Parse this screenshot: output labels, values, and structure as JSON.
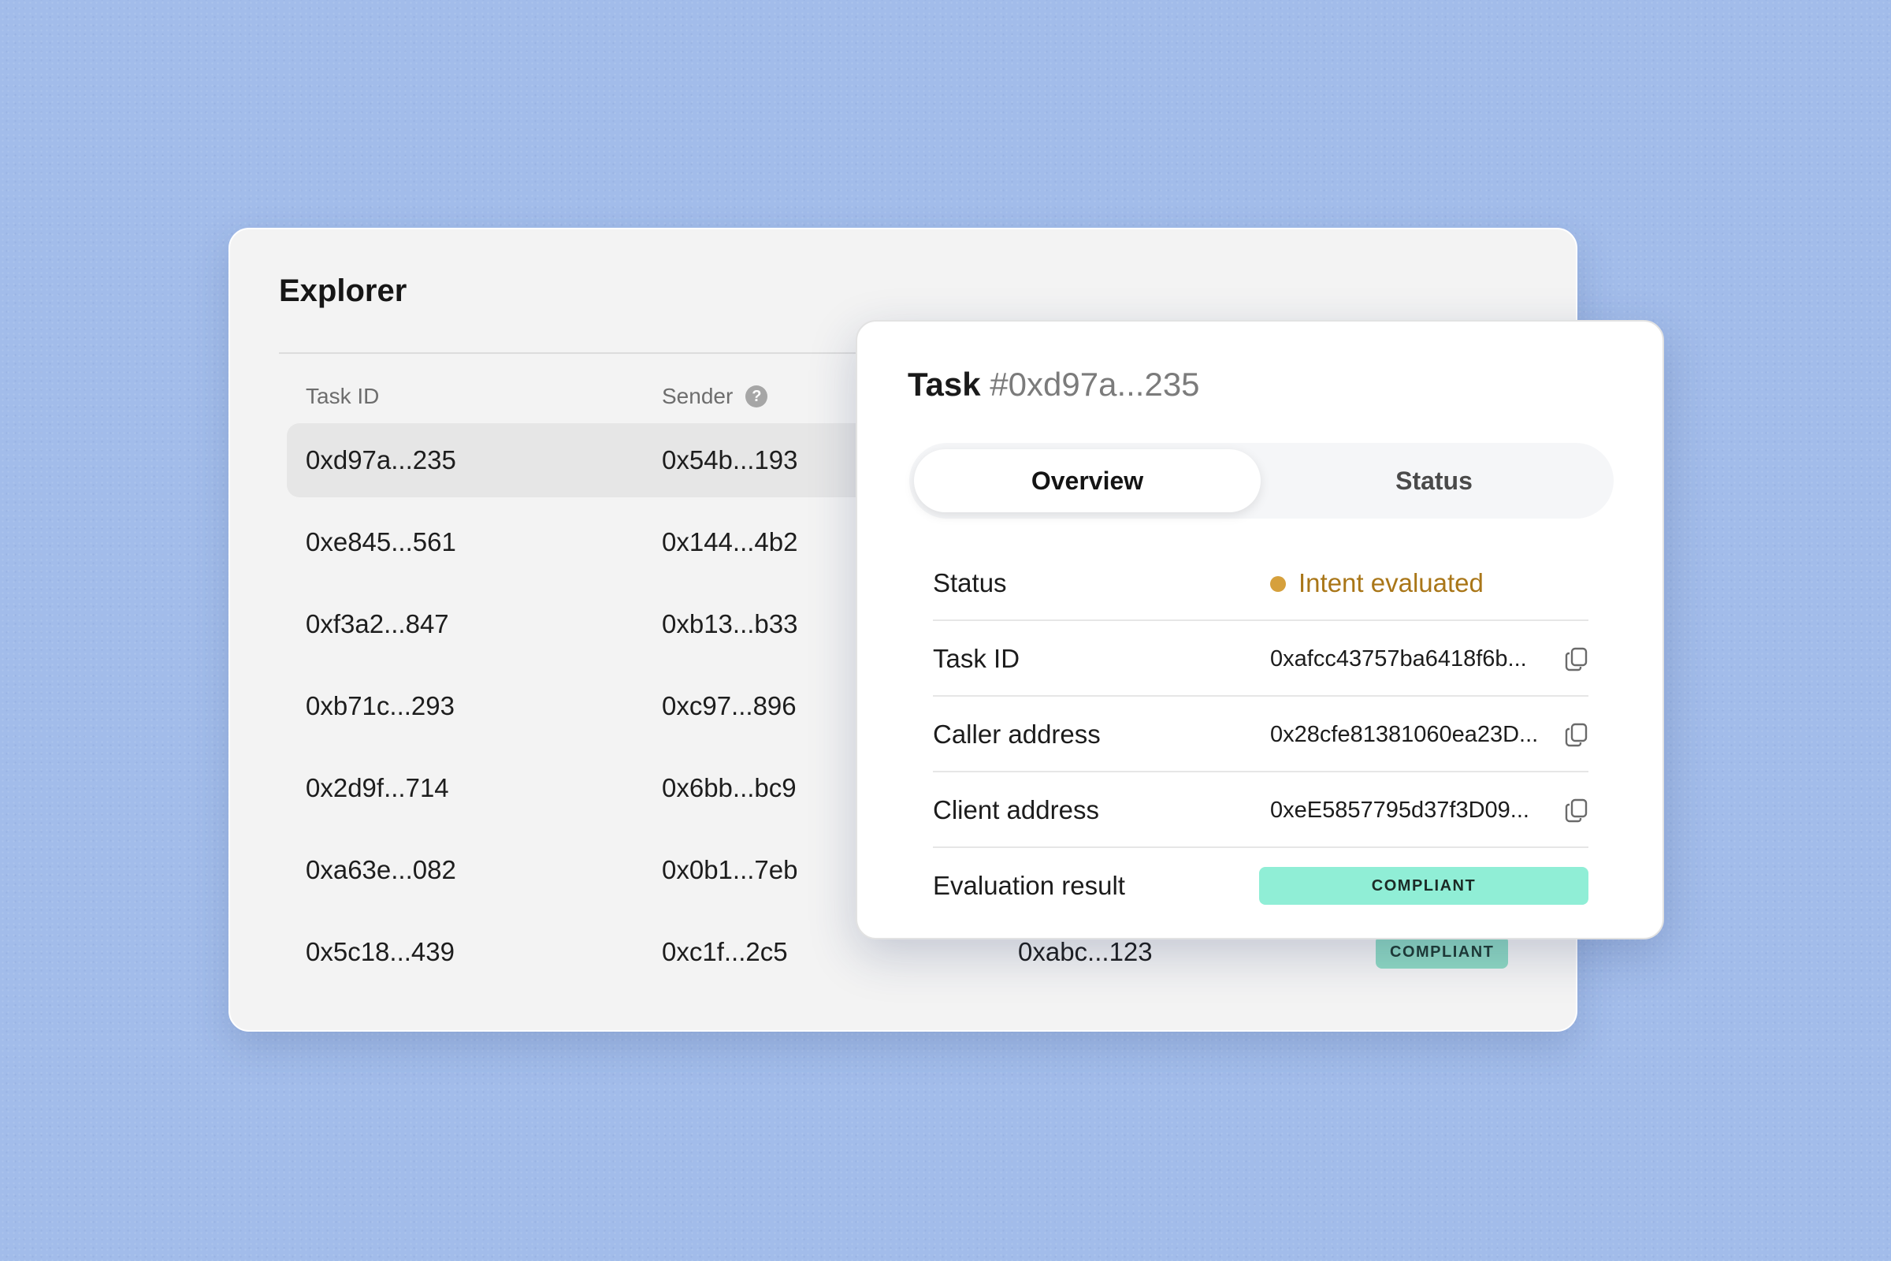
{
  "explorer": {
    "title": "Explorer",
    "columns": {
      "task_id": "Task ID",
      "sender": "Sender"
    },
    "rows": [
      {
        "task_id": "0xd97a...235",
        "sender": "0x54b...193"
      },
      {
        "task_id": "0xe845...561",
        "sender": "0x144...4b2"
      },
      {
        "task_id": "0xf3a2...847",
        "sender": "0xb13...b33"
      },
      {
        "task_id": "0xb71c...293",
        "sender": "0xc97...896"
      },
      {
        "task_id": "0x2d9f...714",
        "sender": "0x6bb...bc9"
      },
      {
        "task_id": "0xa63e...082",
        "sender": "0x0b1...7eb"
      },
      {
        "task_id": "0x5c18...439",
        "sender": "0xc1f...2c5",
        "client": "0xabc...123",
        "result": "COMPLIANT"
      }
    ]
  },
  "detail": {
    "title_label": "Task",
    "title_hash": "#0xd97a...235",
    "tabs": {
      "overview": "Overview",
      "status": "Status"
    },
    "fields": {
      "status": {
        "label": "Status",
        "value": "Intent evaluated",
        "color": "#d6a03c"
      },
      "task_id": {
        "label": "Task ID",
        "value": "0xafcc43757ba6418f6b..."
      },
      "caller": {
        "label": "Caller address",
        "value": "0x28cfe81381060ea23D..."
      },
      "client": {
        "label": "Client address",
        "value": "0xeE5857795d37f3D09..."
      },
      "evaluation": {
        "label": "Evaluation result",
        "value": "COMPLIANT"
      }
    }
  },
  "colors": {
    "background": "#a2bcea",
    "compliant_badge": "#90eed6",
    "status_pending": "#d6a03c"
  }
}
